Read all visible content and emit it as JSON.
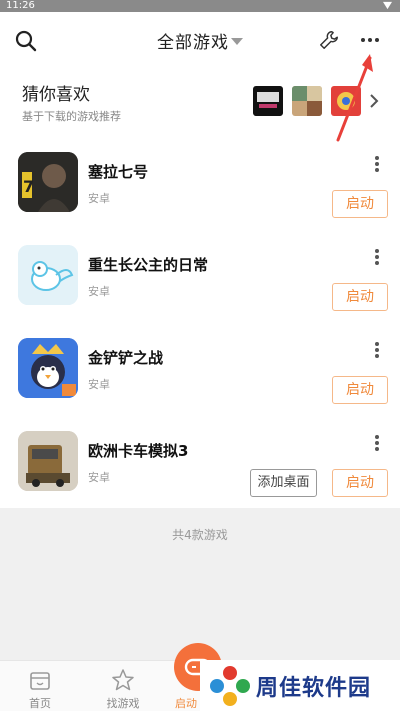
{
  "status_bar": {
    "time": "11:26"
  },
  "header": {
    "title": "全部游戏"
  },
  "recommend": {
    "title": "猜你喜欢",
    "subtitle": "基于下载的游戏推荐"
  },
  "games": [
    {
      "name": "塞拉七号",
      "platform": "安卓",
      "launch_label": "启动"
    },
    {
      "name": "重生长公主的日常",
      "platform": "安卓",
      "launch_label": "启动"
    },
    {
      "name": "金铲铲之战",
      "platform": "安卓",
      "launch_label": "启动"
    },
    {
      "name": "欧洲卡车模拟3",
      "platform": "安卓",
      "launch_label": "启动",
      "desktop_label": "添加桌面"
    }
  ],
  "summary": {
    "count_text": "共4款游戏"
  },
  "tabs": [
    {
      "label": "首页",
      "icon": "home-icon"
    },
    {
      "label": "找游戏",
      "icon": "star-icon"
    },
    {
      "label": "启动",
      "icon": "gamepad-icon"
    }
  ],
  "watermark": {
    "text": "周佳软件园"
  },
  "colors": {
    "accent": "#f08a3c",
    "fab": "#f4703b",
    "watermark": "#1d3a8a"
  }
}
